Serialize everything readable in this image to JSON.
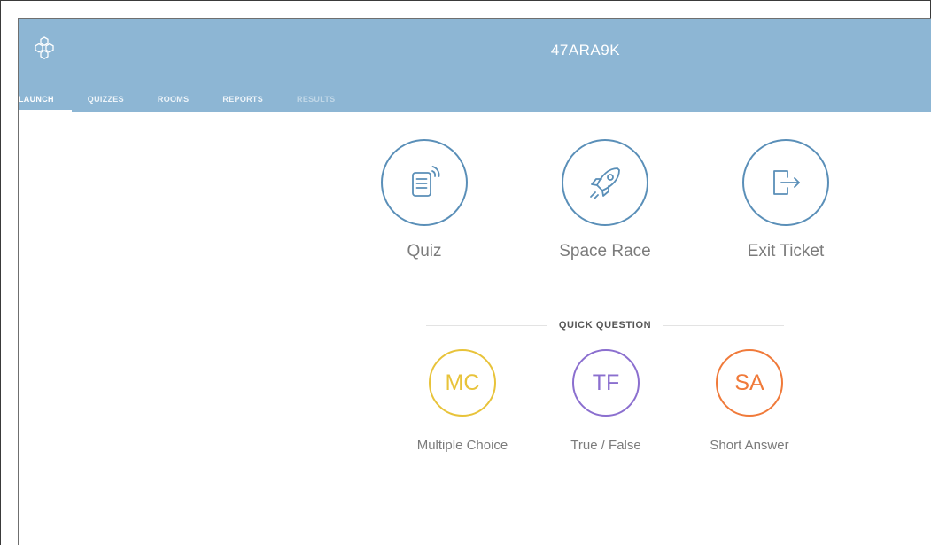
{
  "header": {
    "room_code": "47ARA9K",
    "logo_icon": "hexagon-cluster-icon",
    "background_color": "#8db6d4"
  },
  "nav": {
    "items": [
      {
        "label": "LAUNCH",
        "state": "active"
      },
      {
        "label": "QUIZZES",
        "state": "normal"
      },
      {
        "label": "ROOMS",
        "state": "normal"
      },
      {
        "label": "REPORTS",
        "state": "normal"
      },
      {
        "label": "RESULTS",
        "state": "disabled"
      }
    ]
  },
  "launch": {
    "activities": [
      {
        "label": "Quiz",
        "icon": "quiz-document-icon",
        "color": "#5a8fb8"
      },
      {
        "label": "Space Race",
        "icon": "rocket-icon",
        "color": "#5a8fb8"
      },
      {
        "label": "Exit Ticket",
        "icon": "exit-door-icon",
        "color": "#5a8fb8"
      }
    ]
  },
  "quick_question": {
    "heading": "QUICK QUESTION",
    "options": [
      {
        "abbr": "MC",
        "label": "Multiple Choice",
        "color": "#e8c33a"
      },
      {
        "abbr": "TF",
        "label": "True / False",
        "color": "#8b6fcf"
      },
      {
        "abbr": "SA",
        "label": "Short Answer",
        "color": "#f07a3a"
      }
    ]
  }
}
